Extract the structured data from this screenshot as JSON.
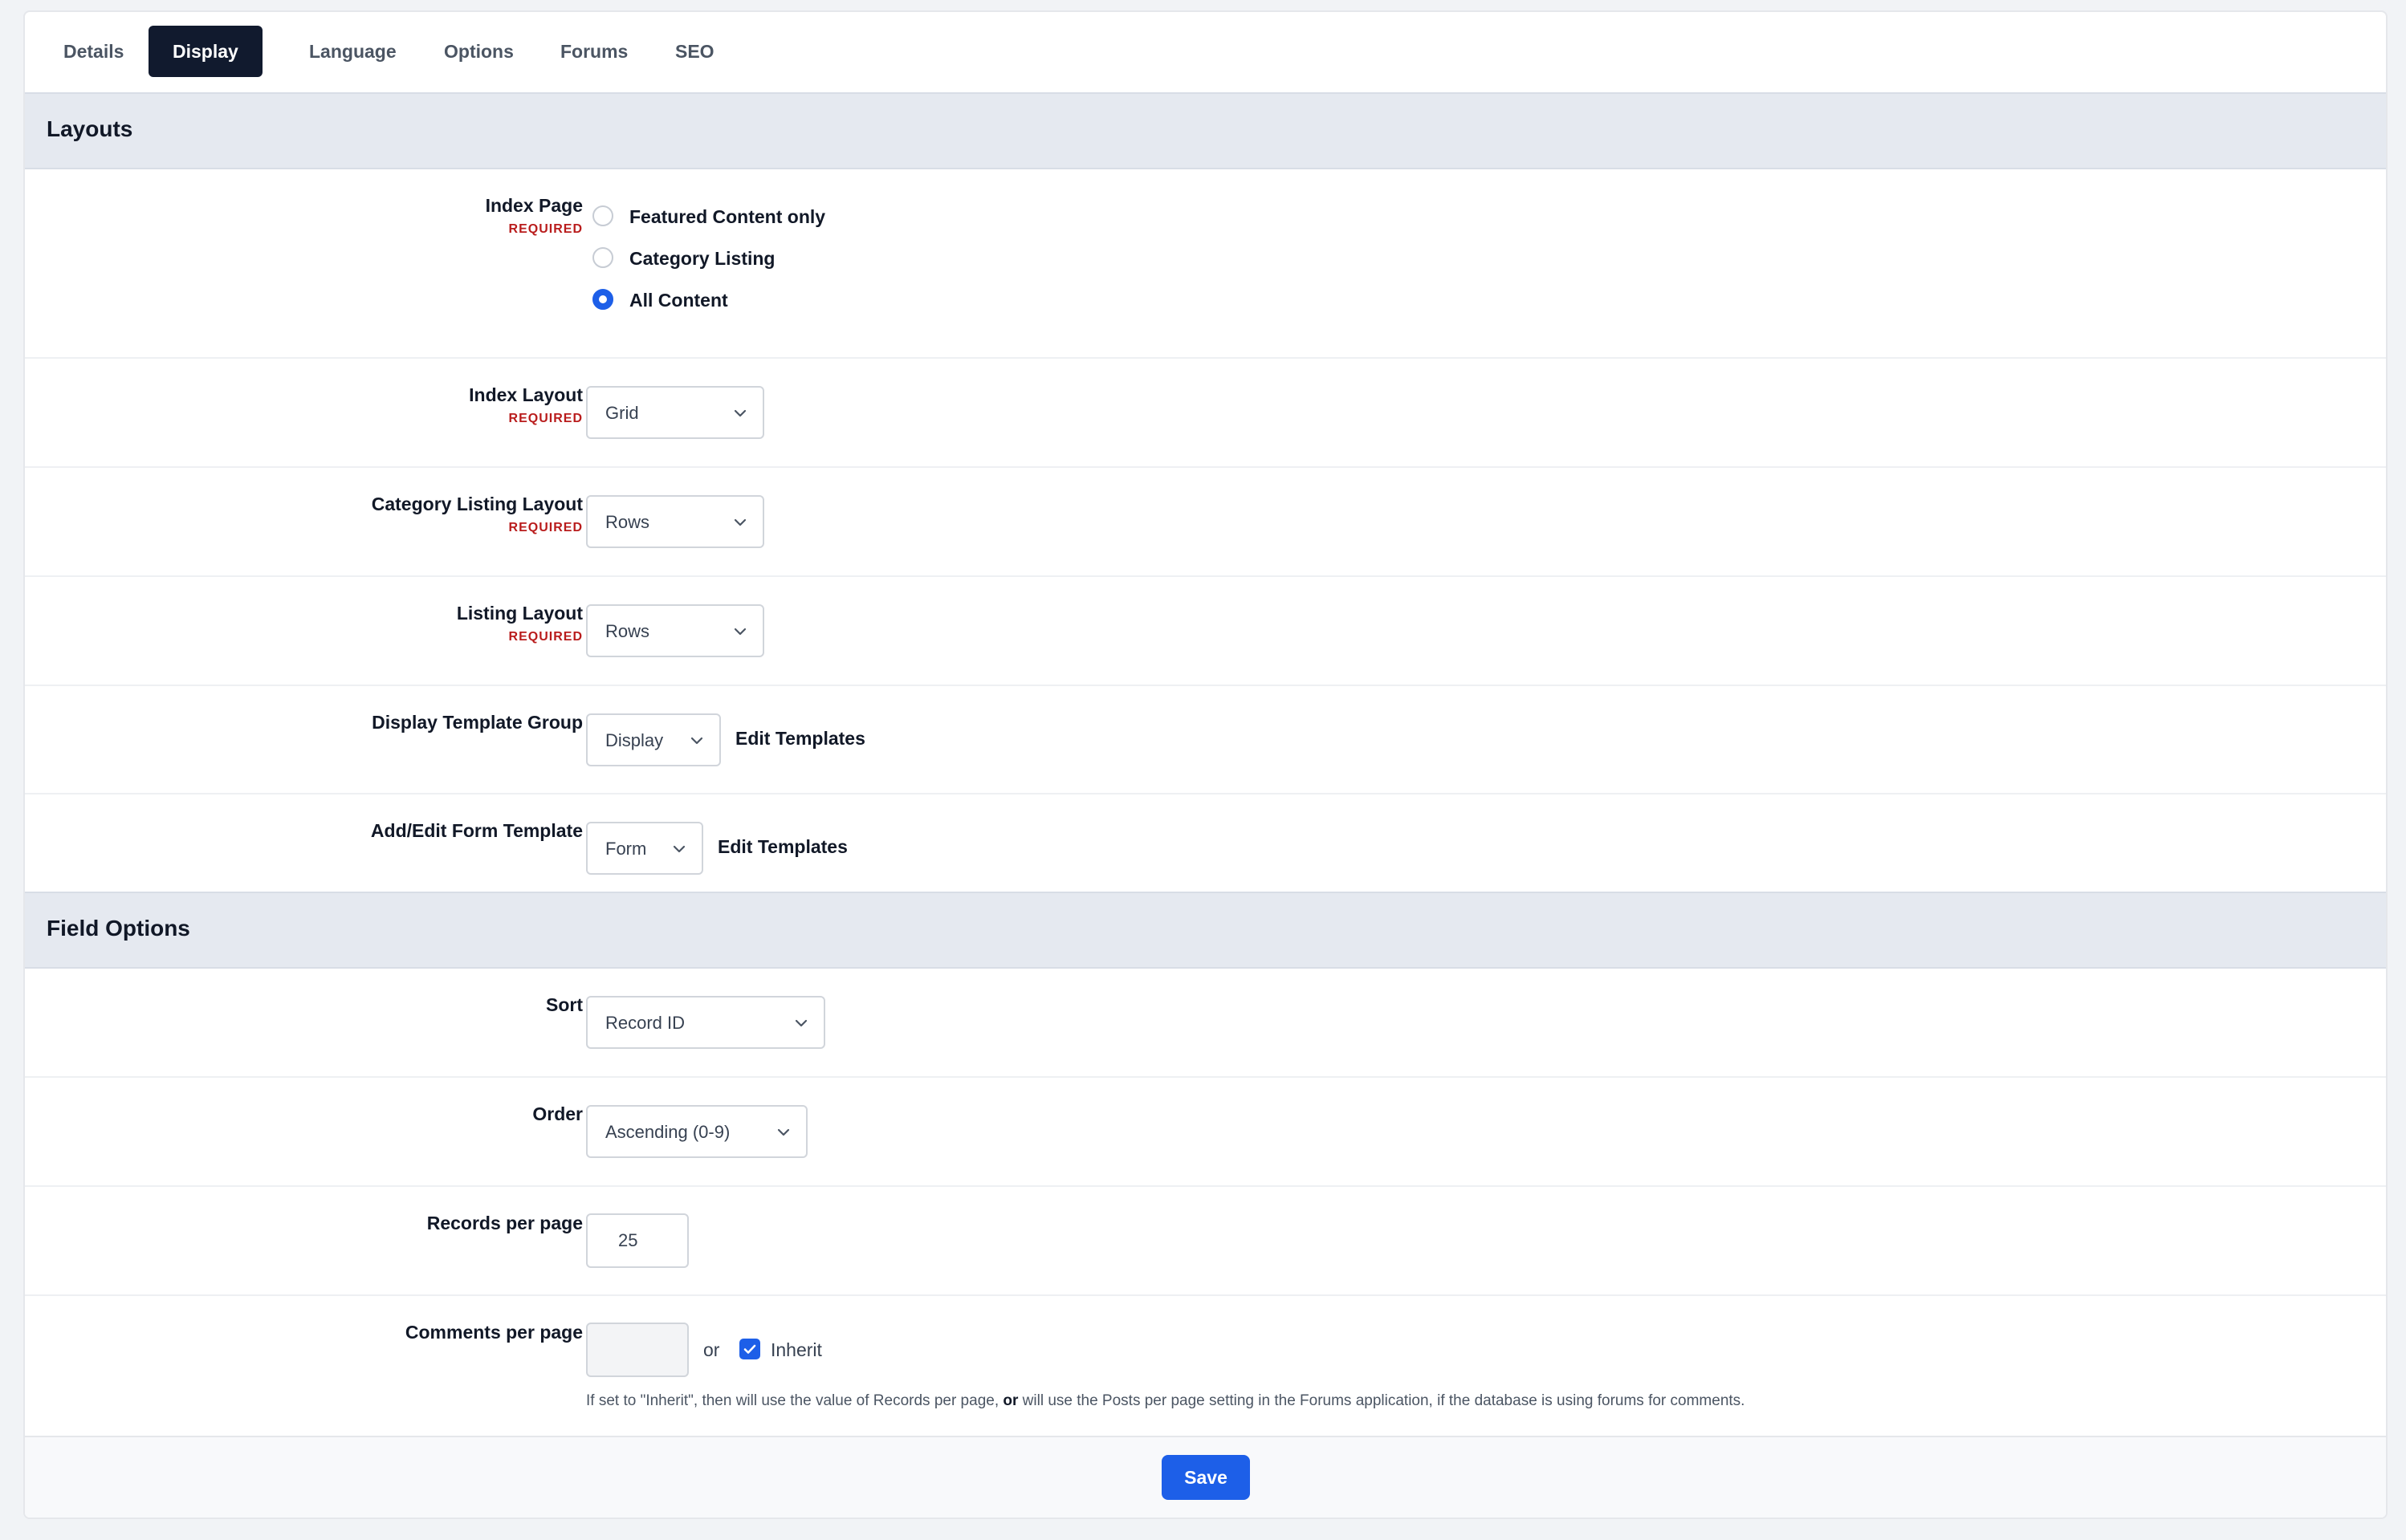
{
  "tabs": [
    "Details",
    "Display",
    "Language",
    "Options",
    "Forums",
    "SEO"
  ],
  "active_tab": "Display",
  "required_text": "REQUIRED",
  "layouts": {
    "title": "Layouts",
    "index_page": {
      "label": "Index Page",
      "options": [
        "Featured Content only",
        "Category Listing",
        "All Content"
      ],
      "selected": "All Content"
    },
    "index_layout": {
      "label": "Index Layout",
      "value": "Grid"
    },
    "category_listing_layout": {
      "label": "Category Listing Layout",
      "value": "Rows"
    },
    "listing_layout": {
      "label": "Listing Layout",
      "value": "Rows"
    },
    "display_template_group": {
      "label": "Display Template Group",
      "value": "Display",
      "link": "Edit Templates"
    },
    "add_edit_form_template": {
      "label": "Add/Edit Form Template",
      "value": "Form",
      "link": "Edit Templates"
    }
  },
  "field_options": {
    "title": "Field Options",
    "sort": {
      "label": "Sort",
      "value": "Record ID"
    },
    "order": {
      "label": "Order",
      "value": "Ascending (0-9)"
    },
    "records_per_page": {
      "label": "Records per page",
      "value": "25"
    },
    "comments_per_page": {
      "label": "Comments per page",
      "value": "",
      "or_text": "or",
      "inherit_label": "Inherit",
      "inherit_checked": true,
      "help_before": "If set to \"Inherit\", then will use the value of Records per page, ",
      "help_bold": "or",
      "help_after": " will use the Posts per page setting in the Forums application, if the database is using forums for comments."
    }
  },
  "footer": {
    "save_label": "Save"
  },
  "colors": {
    "accent": "#1d5fe8",
    "active_tab_bg": "#111a2e",
    "required": "#b91c1c",
    "section_bg": "#e5e9f0"
  }
}
